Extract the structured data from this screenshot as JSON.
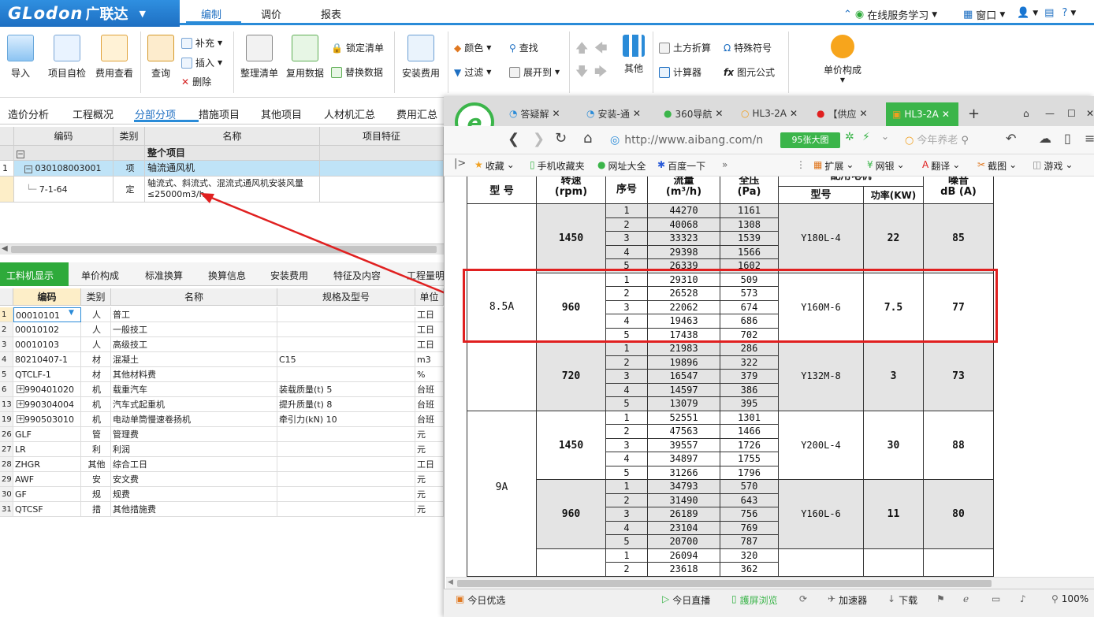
{
  "app": {
    "brand": "GLodon",
    "brand_cn": "广联达",
    "menus": [
      "编制",
      "调价",
      "报表"
    ],
    "active_menu": "编制",
    "top_right": {
      "online": "在线服务学习",
      "window": "窗口",
      "help": "?"
    }
  },
  "ribbon": {
    "import": "导入",
    "self_check": "项目自检",
    "cost_view": "费用查看",
    "query": "查询",
    "supplement": "补充",
    "insert": "插入",
    "delete": "删除",
    "organize": "整理清单",
    "reuse": "复用数据",
    "lock": "锁定清单",
    "replace": "替换数据",
    "install_fee": "安装费用",
    "color": "颜色",
    "find": "查找",
    "filter": "过滤",
    "expand": "展开到",
    "other": "其他",
    "earthwork": "土方折算",
    "special_char": "特殊符号",
    "calculator": "计算器",
    "formula": "图元公式",
    "unit_price": "单价构成"
  },
  "main_tabs": [
    "造价分析",
    "工程概况",
    "分部分项",
    "措施项目",
    "其他项目",
    "人材机汇总",
    "费用汇总"
  ],
  "active_main_tab": "分部分项",
  "grid1": {
    "headers": [
      "编码",
      "类别",
      "名称",
      "项目特征"
    ],
    "rows": [
      {
        "num": "",
        "code": "",
        "type": "",
        "name": "整个项目",
        "feature": ""
      },
      {
        "num": "1",
        "code": "030108003001",
        "type": "项",
        "name": "轴流通风机",
        "feature": ""
      },
      {
        "num": "",
        "code": "7-1-64",
        "type": "定",
        "name": "轴流式、斜流式、混流式通风机安装风量≤25000m3/h",
        "feature": ""
      }
    ]
  },
  "sub_tabs": [
    "工料机显示",
    "单价构成",
    "标准换算",
    "换算信息",
    "安装费用",
    "特征及内容",
    "工程量明"
  ],
  "active_sub_tab": "工料机显示",
  "grid2": {
    "headers": [
      "编码",
      "类别",
      "名称",
      "规格及型号",
      "单位"
    ],
    "rows": [
      {
        "num": "1",
        "code": "00010101",
        "type": "人",
        "name": "普工",
        "spec": "",
        "unit": "工日"
      },
      {
        "num": "2",
        "code": "00010102",
        "type": "人",
        "name": "一般技工",
        "spec": "",
        "unit": "工日"
      },
      {
        "num": "3",
        "code": "00010103",
        "type": "人",
        "name": "高级技工",
        "spec": "",
        "unit": "工日"
      },
      {
        "num": "4",
        "code": "80210407-1",
        "type": "材",
        "name": "混凝土",
        "spec": "C15",
        "unit": "m3"
      },
      {
        "num": "5",
        "code": "QTCLF-1",
        "type": "材",
        "name": "其他材料费",
        "spec": "",
        "unit": "%"
      },
      {
        "num": "6",
        "code": "990401020",
        "type": "机",
        "name": "载重汽车",
        "spec": "装载质量(t) 5",
        "unit": "台班"
      },
      {
        "num": "13",
        "code": "990304004",
        "type": "机",
        "name": "汽车式起重机",
        "spec": "提升质量(t) 8",
        "unit": "台班"
      },
      {
        "num": "19",
        "code": "990503010",
        "type": "机",
        "name": "电动单筒慢速卷扬机",
        "spec": "牵引力(kN) 10",
        "unit": "台班"
      },
      {
        "num": "26",
        "code": "GLF",
        "type": "管",
        "name": "管理费",
        "spec": "",
        "unit": "元"
      },
      {
        "num": "27",
        "code": "LR",
        "type": "利",
        "name": "利润",
        "spec": "",
        "unit": "元"
      },
      {
        "num": "28",
        "code": "ZHGR",
        "type": "其他",
        "name": "综合工日",
        "spec": "",
        "unit": "工日"
      },
      {
        "num": "29",
        "code": "AWF",
        "type": "安",
        "name": "安文费",
        "spec": "",
        "unit": "元"
      },
      {
        "num": "30",
        "code": "GF",
        "type": "规",
        "name": "规费",
        "spec": "",
        "unit": "元"
      },
      {
        "num": "31",
        "code": "QTCSF",
        "type": "措",
        "name": "其他措施费",
        "spec": "",
        "unit": "元"
      }
    ]
  },
  "browser": {
    "tabs": [
      "答疑解",
      "安装-通",
      "360导航",
      "HL3-2A",
      "【供应",
      "HL3-2A"
    ],
    "url": "http://www.aibang.com/n",
    "bigimg": "95张大图",
    "search_placeholder": "今年养老",
    "fav": [
      "收藏",
      "手机收藏夹",
      "网址大全",
      "百度一下"
    ],
    "fav_right": [
      "扩展",
      "网银",
      "翻译",
      "截图",
      "游戏"
    ],
    "status_left": "今日优选",
    "status_items": [
      "今日直播",
      "護屏浏览",
      "加速器",
      "下载"
    ],
    "zoom": "100%"
  },
  "spec_table": {
    "headers": {
      "model": "型 号",
      "speed": "转速",
      "speed_unit": "(rpm)",
      "seq": "序号",
      "flow": "流量",
      "flow_unit": "(m³/h)",
      "pressure": "全压",
      "pressure_unit": "(Pa)",
      "motor": "配用电机",
      "motor_model": "型号",
      "power": "功率(KW)",
      "noise": "噪音",
      "noise_unit": "dB (A)"
    },
    "groups": [
      {
        "model": "",
        "speed": "1450",
        "motor": "Y180L-4",
        "power": "22",
        "noise": "85",
        "grey": true,
        "rows": [
          [
            "1",
            "44270",
            "1161"
          ],
          [
            "2",
            "40068",
            "1308"
          ],
          [
            "3",
            "33323",
            "1539"
          ],
          [
            "4",
            "29398",
            "1566"
          ],
          [
            "5",
            "26339",
            "1602"
          ]
        ]
      },
      {
        "model": "8.5A",
        "speed": "960",
        "motor": "Y160M-6",
        "power": "7.5",
        "noise": "77",
        "grey": false,
        "rows": [
          [
            "1",
            "29310",
            "509"
          ],
          [
            "2",
            "26528",
            "573"
          ],
          [
            "3",
            "22062",
            "674"
          ],
          [
            "4",
            "19463",
            "686"
          ],
          [
            "5",
            "17438",
            "702"
          ]
        ]
      },
      {
        "model": "",
        "speed": "720",
        "motor": "Y132M-8",
        "power": "3",
        "noise": "73",
        "grey": true,
        "rows": [
          [
            "1",
            "21983",
            "286"
          ],
          [
            "2",
            "19896",
            "322"
          ],
          [
            "3",
            "16547",
            "379"
          ],
          [
            "4",
            "14597",
            "386"
          ],
          [
            "5",
            "13079",
            "395"
          ]
        ]
      },
      {
        "model": "",
        "speed": "1450",
        "motor": "Y200L-4",
        "power": "30",
        "noise": "88",
        "grey": false,
        "rows": [
          [
            "1",
            "52551",
            "1301"
          ],
          [
            "2",
            "47563",
            "1466"
          ],
          [
            "3",
            "39557",
            "1726"
          ],
          [
            "4",
            "34897",
            "1755"
          ],
          [
            "5",
            "31266",
            "1796"
          ]
        ]
      },
      {
        "model": "9A",
        "speed": "960",
        "motor": "Y160L-6",
        "power": "11",
        "noise": "80",
        "grey": true,
        "rows": [
          [
            "1",
            "34793",
            "570"
          ],
          [
            "2",
            "31490",
            "643"
          ],
          [
            "3",
            "26189",
            "756"
          ],
          [
            "4",
            "23104",
            "769"
          ],
          [
            "5",
            "20700",
            "787"
          ]
        ]
      },
      {
        "model": "",
        "speed": "",
        "motor": "",
        "power": "",
        "noise": "",
        "grey": false,
        "rows": [
          [
            "1",
            "26094",
            "320"
          ],
          [
            "2",
            "23618",
            "362"
          ]
        ]
      }
    ]
  },
  "colors": {
    "accent": "#2a8bd8",
    "highlight_row": "#bfe3f7",
    "arrow": "#e02020",
    "green_tab": "#2eaa3a"
  }
}
